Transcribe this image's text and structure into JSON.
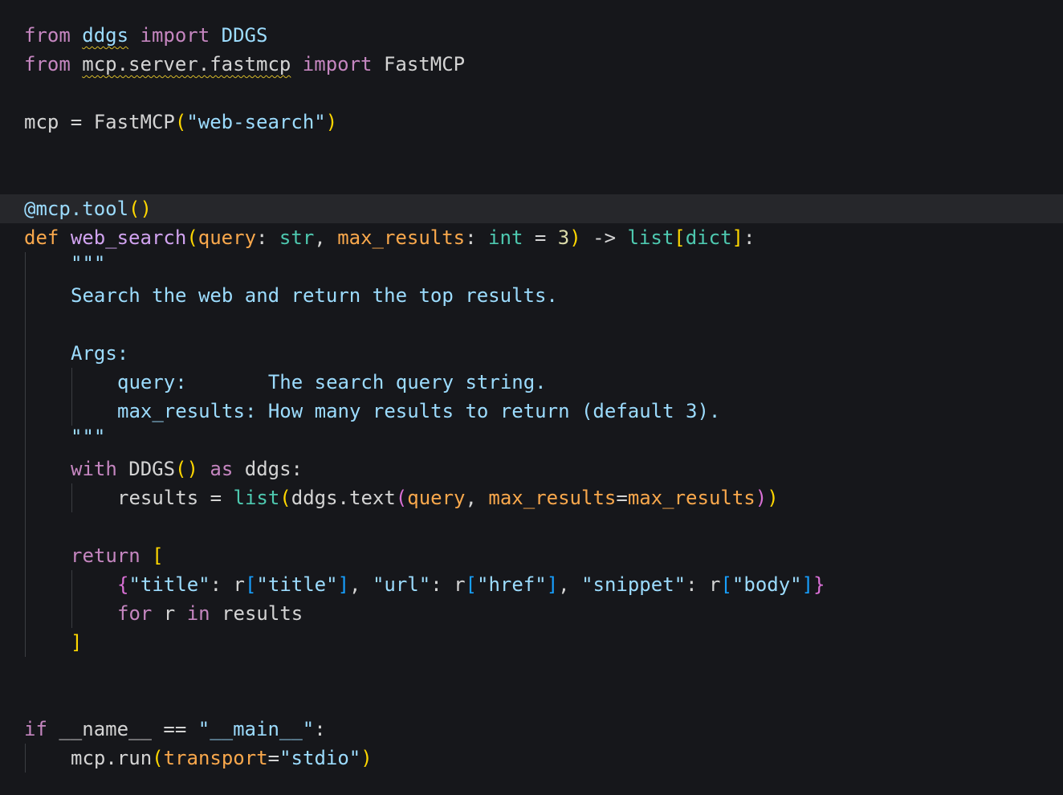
{
  "code": {
    "l1": {
      "a": "from",
      "b": "ddgs",
      "c": "import",
      "d": "DDGS"
    },
    "l2": {
      "a": "from",
      "b": "mcp.server.fastmcp",
      "c": "import",
      "d": "FastMCP"
    },
    "l3": {
      "a": "mcp",
      "b": " = ",
      "c": "FastMCP",
      "d": "(",
      "e": "\"web-search\"",
      "f": ")"
    },
    "l4": {
      "a": "@mcp.tool",
      "b": "()"
    },
    "l5": {
      "a": "def",
      "b": "web_search",
      "c": "(",
      "d": "query",
      "e": ": ",
      "f": "str",
      "g": ", ",
      "h": "max_results",
      "i": ": ",
      "j": "int",
      "k": " = ",
      "l": "3",
      "m": ")",
      "n": " -> ",
      "o": "list",
      "p": "[",
      "q": "dict",
      "r": "]",
      "s": ":"
    },
    "l6": {
      "a": "\"\"\""
    },
    "l7": {
      "a": "Search the web and return the top results."
    },
    "l8": {
      "a": "Args:"
    },
    "l9": {
      "a": "query:       The search query string."
    },
    "l10": {
      "a": "max_results: How many results to return (default 3)."
    },
    "l11": {
      "a": "\"\"\""
    },
    "l12": {
      "a": "with",
      "b": " DDGS",
      "c": "()",
      "d": " as",
      "e": " ddgs:"
    },
    "l13": {
      "a": "results = ",
      "b": "list",
      "c": "(",
      "d": "ddgs.text",
      "e": "(",
      "f": "query",
      "g": ", ",
      "h": "max_results",
      "i": "=",
      "j": "max_results",
      "k": ")",
      "l": ")"
    },
    "l14": {
      "a": "return",
      "b": " ["
    },
    "l15": {
      "a": "{",
      "b": "\"title\"",
      "c": ": r",
      "d": "[",
      "e": "\"title\"",
      "f": "]",
      "g": ", ",
      "h": "\"url\"",
      "i": ": r",
      "j": "[",
      "k": "\"href\"",
      "l": "]",
      "m": ", ",
      "n": "\"snippet\"",
      "o": ": r",
      "p": "[",
      "q": "\"body\"",
      "r": "]",
      "s": "}"
    },
    "l16": {
      "a": "for",
      "b": " r ",
      "c": "in",
      "d": " results"
    },
    "l17": {
      "a": "]"
    },
    "l18": {
      "a": "if",
      "b": " __name__ == ",
      "c": "\"__main__\"",
      "d": ":"
    },
    "l19": {
      "a": "mcp.run",
      "b": "(",
      "c": "transport",
      "d": "=",
      "e": "\"stdio\"",
      "f": ")"
    }
  }
}
